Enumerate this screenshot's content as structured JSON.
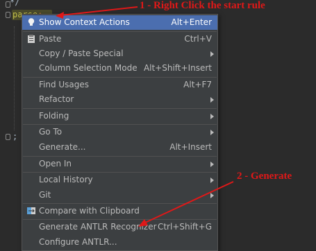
{
  "editor": {
    "top_code": "*/",
    "rule_text": "parse",
    "rule_suffix": ":",
    "end_code": ";"
  },
  "menu": {
    "items": [
      {
        "label": "Show Context Actions",
        "shortcut": "Alt+Enter",
        "icon": "lightbulb-icon",
        "submenu": false,
        "highlight": true
      },
      {
        "label": "Paste",
        "shortcut": "Ctrl+V",
        "icon": "clipboard-icon",
        "submenu": false,
        "highlight": false
      },
      {
        "label": "Copy / Paste Special",
        "shortcut": "",
        "icon": "",
        "submenu": true,
        "highlight": false
      },
      {
        "label": "Column Selection Mode",
        "shortcut": "Alt+Shift+Insert",
        "icon": "",
        "submenu": false,
        "highlight": false
      },
      {
        "label": "Find Usages",
        "shortcut": "Alt+F7",
        "icon": "",
        "submenu": false,
        "highlight": false
      },
      {
        "label": "Refactor",
        "shortcut": "",
        "icon": "",
        "submenu": true,
        "highlight": false
      },
      {
        "label": "Folding",
        "shortcut": "",
        "icon": "",
        "submenu": true,
        "highlight": false
      },
      {
        "label": "Go To",
        "shortcut": "",
        "icon": "",
        "submenu": true,
        "highlight": false
      },
      {
        "label": "Generate...",
        "shortcut": "Alt+Insert",
        "icon": "",
        "submenu": false,
        "highlight": false
      },
      {
        "label": "Open In",
        "shortcut": "",
        "icon": "",
        "submenu": true,
        "highlight": false
      },
      {
        "label": "Local History",
        "shortcut": "",
        "icon": "",
        "submenu": true,
        "highlight": false
      },
      {
        "label": "Git",
        "shortcut": "",
        "icon": "",
        "submenu": true,
        "highlight": false
      },
      {
        "label": "Compare with Clipboard",
        "shortcut": "",
        "icon": "compare-icon",
        "submenu": false,
        "highlight": false
      },
      {
        "label": "Generate ANTLR Recognizer",
        "shortcut": "Ctrl+Shift+G",
        "icon": "",
        "submenu": false,
        "highlight": false
      },
      {
        "label": "Configure ANTLR...",
        "shortcut": "",
        "icon": "",
        "submenu": false,
        "highlight": false
      }
    ]
  },
  "annotations": {
    "step1": "1 - Right Click the start rule",
    "step2": "2 - Generate",
    "color": "#e01818"
  },
  "colors": {
    "menu_bg": "#3c3f41",
    "highlight": "#4b6eaf",
    "editor_bg": "#2b2b2b"
  }
}
